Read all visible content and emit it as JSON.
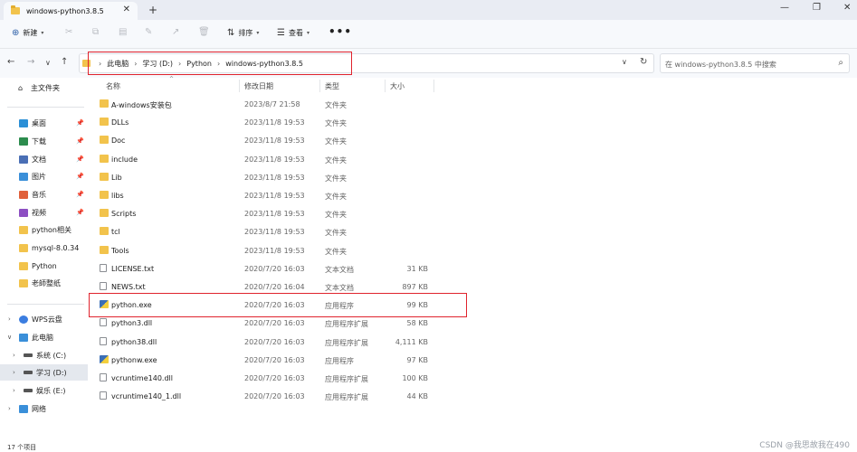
{
  "window": {
    "tab_title": "windows-python3.8.5",
    "tab_close": "✕",
    "new_tab": "+",
    "minimize": "—",
    "maximize": "❐",
    "close": "✕"
  },
  "toolbar": {
    "new_label": "新建",
    "sort_label": "排序",
    "view_label": "查看",
    "more_label": "•••",
    "icons": [
      "cut-icon",
      "copy-icon",
      "paste-icon",
      "rename-icon",
      "share-icon",
      "delete-icon"
    ]
  },
  "address": {
    "breadcrumbs": [
      "此电脑",
      "学习 (D:)",
      "Python",
      "windows-python3.8.5"
    ],
    "search_placeholder": "在 windows-python3.8.5 中搜索"
  },
  "sidebar": {
    "home": "主文件夹",
    "quick_access": [
      {
        "label": "桌面",
        "color": "#2b8fd6"
      },
      {
        "label": "下载",
        "color": "#2c8c4e"
      },
      {
        "label": "文档",
        "color": "#4a6fb5"
      },
      {
        "label": "图片",
        "color": "#3a8fd9"
      },
      {
        "label": "音乐",
        "color": "#e0603a"
      },
      {
        "label": "视频",
        "color": "#8d4fc2"
      },
      {
        "label": "python相关",
        "color": "#f2c34c"
      },
      {
        "label": "mysql-8.0.34",
        "color": "#f2c34c"
      },
      {
        "label": "Python",
        "color": "#f2c34c"
      },
      {
        "label": "老師整纸",
        "color": "#f2c34c"
      }
    ],
    "wps": "WPS云盘",
    "this_pc": "此电脑",
    "drives": [
      {
        "label": "系统 (C:)"
      },
      {
        "label": "学习 (D:)"
      },
      {
        "label": "娱乐 (E:)"
      }
    ],
    "network": "网络"
  },
  "columns": {
    "name": "名称",
    "modified": "修改日期",
    "type": "类型",
    "size": "大小"
  },
  "files": [
    {
      "name": "A-windows安装包",
      "date": "2023/8/7 21:58",
      "type": "文件夹",
      "size": "",
      "kind": "folder"
    },
    {
      "name": "DLLs",
      "date": "2023/11/8 19:53",
      "type": "文件夹",
      "size": "",
      "kind": "folder"
    },
    {
      "name": "Doc",
      "date": "2023/11/8 19:53",
      "type": "文件夹",
      "size": "",
      "kind": "folder"
    },
    {
      "name": "include",
      "date": "2023/11/8 19:53",
      "type": "文件夹",
      "size": "",
      "kind": "folder"
    },
    {
      "name": "Lib",
      "date": "2023/11/8 19:53",
      "type": "文件夹",
      "size": "",
      "kind": "folder"
    },
    {
      "name": "libs",
      "date": "2023/11/8 19:53",
      "type": "文件夹",
      "size": "",
      "kind": "folder"
    },
    {
      "name": "Scripts",
      "date": "2023/11/8 19:53",
      "type": "文件夹",
      "size": "",
      "kind": "folder"
    },
    {
      "name": "tcl",
      "date": "2023/11/8 19:53",
      "type": "文件夹",
      "size": "",
      "kind": "folder"
    },
    {
      "name": "Tools",
      "date": "2023/11/8 19:53",
      "type": "文件夹",
      "size": "",
      "kind": "folder"
    },
    {
      "name": "LICENSE.txt",
      "date": "2020/7/20 16:03",
      "type": "文本文档",
      "size": "31 KB",
      "kind": "file"
    },
    {
      "name": "NEWS.txt",
      "date": "2020/7/20 16:04",
      "type": "文本文档",
      "size": "897 KB",
      "kind": "file"
    },
    {
      "name": "python.exe",
      "date": "2020/7/20 16:03",
      "type": "应用程序",
      "size": "99 KB",
      "kind": "exe"
    },
    {
      "name": "python3.dll",
      "date": "2020/7/20 16:03",
      "type": "应用程序扩展",
      "size": "58 KB",
      "kind": "file"
    },
    {
      "name": "python38.dll",
      "date": "2020/7/20 16:03",
      "type": "应用程序扩展",
      "size": "4,111 KB",
      "kind": "file"
    },
    {
      "name": "pythonw.exe",
      "date": "2020/7/20 16:03",
      "type": "应用程序",
      "size": "97 KB",
      "kind": "exe"
    },
    {
      "name": "vcruntime140.dll",
      "date": "2020/7/20 16:03",
      "type": "应用程序扩展",
      "size": "100 KB",
      "kind": "file"
    },
    {
      "name": "vcruntime140_1.dll",
      "date": "2020/7/20 16:03",
      "type": "应用程序扩展",
      "size": "44 KB",
      "kind": "file"
    }
  ],
  "status": "17 个项目",
  "watermark": "CSDN @我思故我在490"
}
